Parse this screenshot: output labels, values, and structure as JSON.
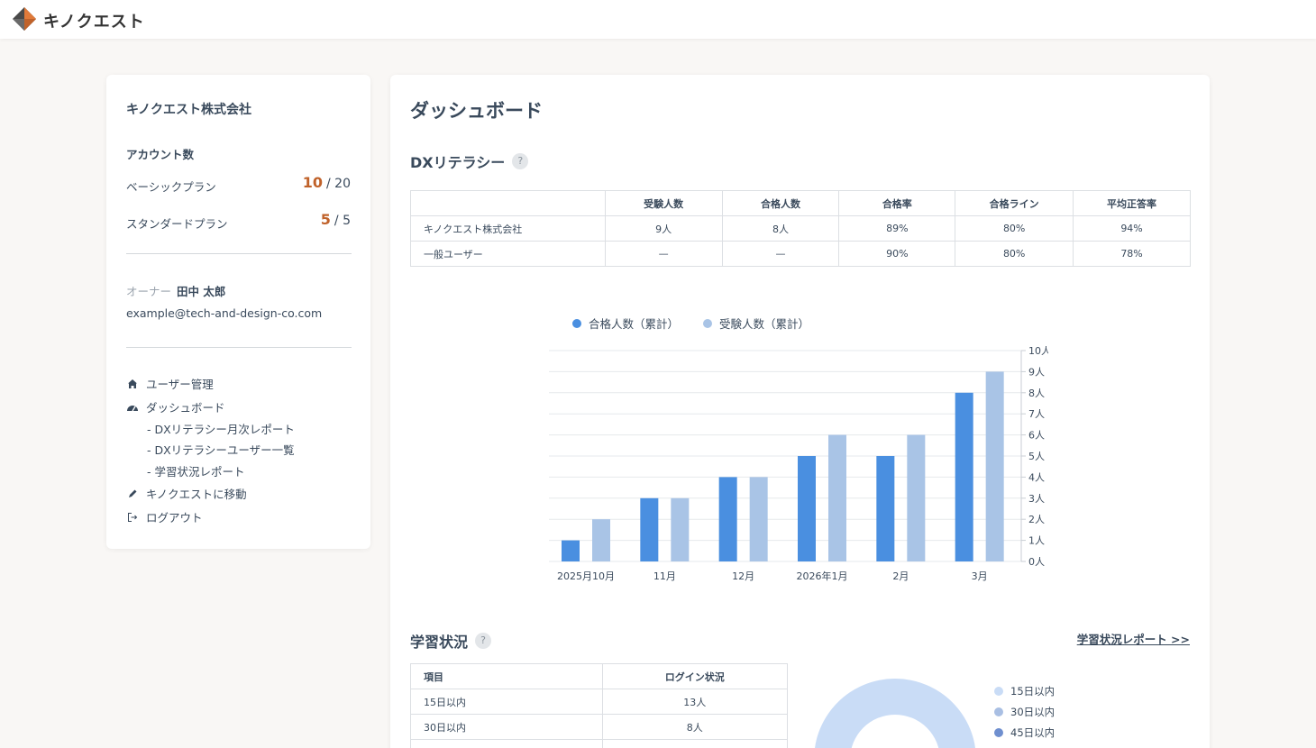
{
  "header": {
    "brand": "キノクエスト"
  },
  "sidebar": {
    "company": "キノクエスト株式会社",
    "account_title": "アカウント数",
    "plans": [
      {
        "label": "ベーシックプラン",
        "used": "10",
        "total": "/ 20"
      },
      {
        "label": "スタンダードプラン",
        "used": "5",
        "total": "/ 5"
      }
    ],
    "owner_label": "オーナー",
    "owner_name": "田中 太郎",
    "email": "example@tech-and-design-co.com",
    "nav": {
      "users": "ユーザー管理",
      "dashboard": "ダッシュボード",
      "sub1": "- DXリテラシー月次レポート",
      "sub2": "- DXリテラシーユーザー一覧",
      "sub3": "- 学習状況レポート",
      "goto": "キノクエストに移動",
      "logout": "ログアウト"
    }
  },
  "main": {
    "title": "ダッシュボード",
    "dx_title": "DXリテラシー",
    "help": "?",
    "dx_table": {
      "headers": [
        "",
        "受験人数",
        "合格人数",
        "合格率",
        "合格ライン",
        "平均正答率"
      ],
      "rows": [
        [
          "キノクエスト株式会社",
          "9人",
          "8人",
          "89%",
          "80%",
          "94%"
        ],
        [
          "一般ユーザー",
          "—",
          "—",
          "90%",
          "80%",
          "78%"
        ]
      ]
    },
    "study_title": "学習状況",
    "report_link": "学習状況レポート >>",
    "study_table": {
      "headers": [
        "項目",
        "ログイン状況"
      ],
      "rows": [
        [
          "15日以内",
          "13人"
        ],
        [
          "30日以内",
          "8人"
        ]
      ]
    },
    "donut_legend": [
      "15日以内",
      "30日以内",
      "45日以内"
    ]
  },
  "colors": {
    "pass": "#4a8fe0",
    "exam": "#a9c4e6",
    "accent": "#c0622a",
    "donut1": "#c9dcf6",
    "donut2": "#a9bfe3",
    "donut3": "#6f8fcf"
  },
  "chart_data": {
    "type": "bar",
    "categories": [
      "2025月10月",
      "11月",
      "12月",
      "2026年1月",
      "2月",
      "3月"
    ],
    "series": [
      {
        "name": "合格人数（累計）",
        "values": [
          1,
          3,
          4,
          5,
          5,
          8
        ]
      },
      {
        "name": "受験人数（累計）",
        "values": [
          2,
          3,
          4,
          6,
          6,
          9
        ]
      }
    ],
    "yticks": [
      "0人",
      "1人",
      "2人",
      "3人",
      "4人",
      "5人",
      "6人",
      "7人",
      "8人",
      "9人",
      "10人"
    ],
    "ylim": [
      0,
      10
    ],
    "grid": true,
    "y_axis_side": "right",
    "legend": "top"
  }
}
